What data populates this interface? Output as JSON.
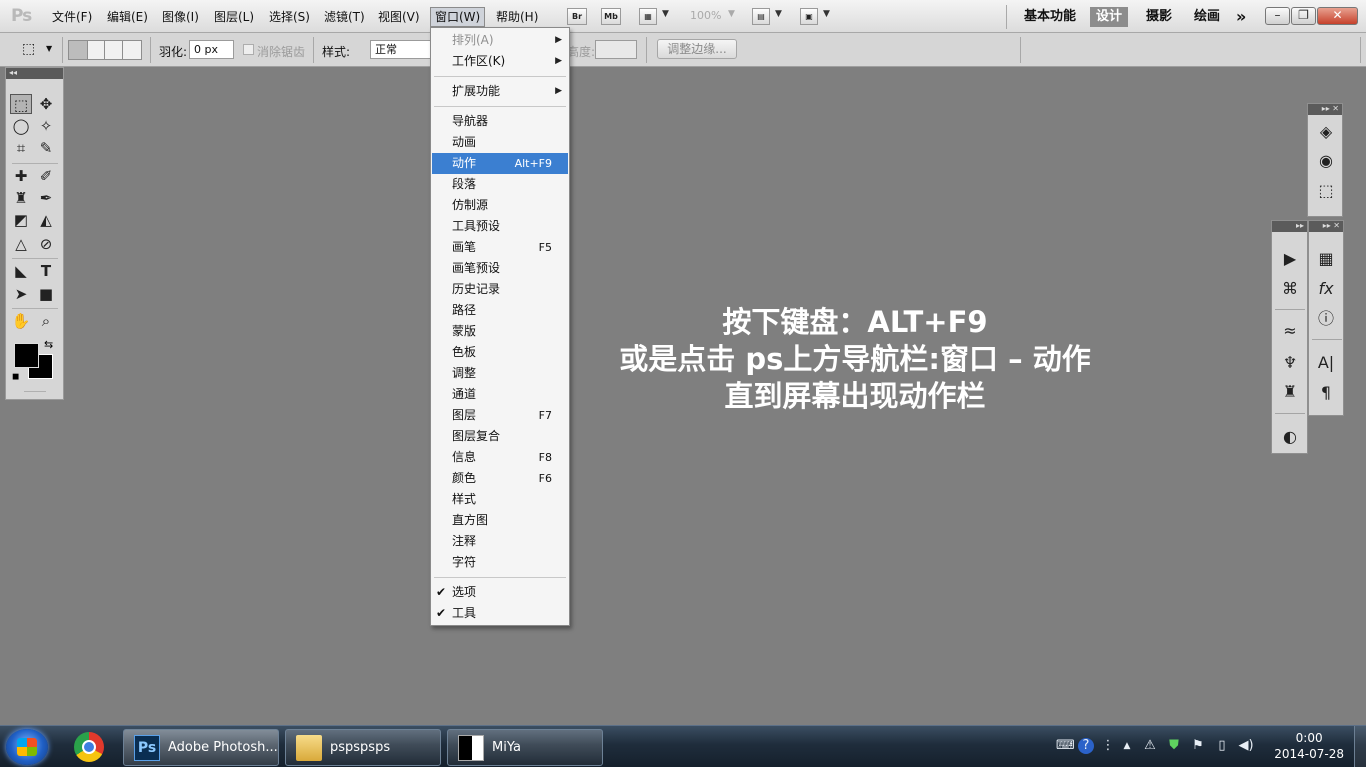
{
  "app": {
    "logo": "Ps"
  },
  "menubar": {
    "items": [
      "文件(F)",
      "编辑(E)",
      "图像(I)",
      "图层(L)",
      "选择(S)",
      "滤镜(T)",
      "视图(V)",
      "窗口(W)",
      "帮助(H)"
    ],
    "active_index": 7,
    "bridge_label": "Br",
    "minibridge_label": "Mb",
    "zoom_level": "100%",
    "workspaces": [
      "基本功能",
      "设计",
      "摄影",
      "绘画"
    ],
    "active_workspace": "设计",
    "more_label": "»"
  },
  "options": {
    "feather_label": "羽化:",
    "feather_value": "0 px",
    "antialias_label": "消除锯齿",
    "style_label": "样式:",
    "style_value": "正常",
    "height_label": "高度:",
    "refine_edge_label": "调整边缘..."
  },
  "window_menu": {
    "items": [
      {
        "label": "排列(A)",
        "submenu": true,
        "disabled": true
      },
      {
        "label": "工作区(K)",
        "submenu": true
      },
      {
        "separator": true
      },
      {
        "label": "扩展功能",
        "submenu": true
      },
      {
        "separator": true
      },
      {
        "label": "导航器"
      },
      {
        "label": "动画"
      },
      {
        "label": "动作",
        "shortcut": "Alt+F9",
        "highlighted": true
      },
      {
        "label": "段落"
      },
      {
        "label": "仿制源"
      },
      {
        "label": "工具预设"
      },
      {
        "label": "画笔",
        "shortcut": "F5"
      },
      {
        "label": "画笔预设"
      },
      {
        "label": "历史记录"
      },
      {
        "label": "路径"
      },
      {
        "label": "蒙版"
      },
      {
        "label": "色板"
      },
      {
        "label": "调整"
      },
      {
        "label": "通道"
      },
      {
        "label": "图层",
        "shortcut": "F7"
      },
      {
        "label": "图层复合"
      },
      {
        "label": "信息",
        "shortcut": "F8"
      },
      {
        "label": "颜色",
        "shortcut": "F6"
      },
      {
        "label": "样式"
      },
      {
        "label": "直方图"
      },
      {
        "label": "注释"
      },
      {
        "label": "字符"
      },
      {
        "separator": true
      },
      {
        "label": "选项",
        "checked": true
      },
      {
        "label": "工具",
        "checked": true
      }
    ]
  },
  "caption": {
    "line1": "按下键盘：ALT+F9",
    "line2": "或是点击 ps上方导航栏:窗口 – 动作",
    "line3": "直到屏幕出现动作栏"
  },
  "taskbar": {
    "apps": [
      {
        "label": "Adobe Photosh...",
        "icon": "photoshop-icon",
        "active": true
      },
      {
        "label": "pspspsps",
        "icon": "folder-icon"
      },
      {
        "label": "MiYa",
        "icon": "window-thumbnail-icon"
      }
    ],
    "clock_time": "0:00",
    "clock_date": "2014-07-28"
  },
  "colors": {
    "menu_highlight": "#3b7fd1",
    "canvas_bg": "#7f7f7f",
    "active_workspace_bg": "#8c8c8c",
    "close_button": "#c6412b"
  }
}
